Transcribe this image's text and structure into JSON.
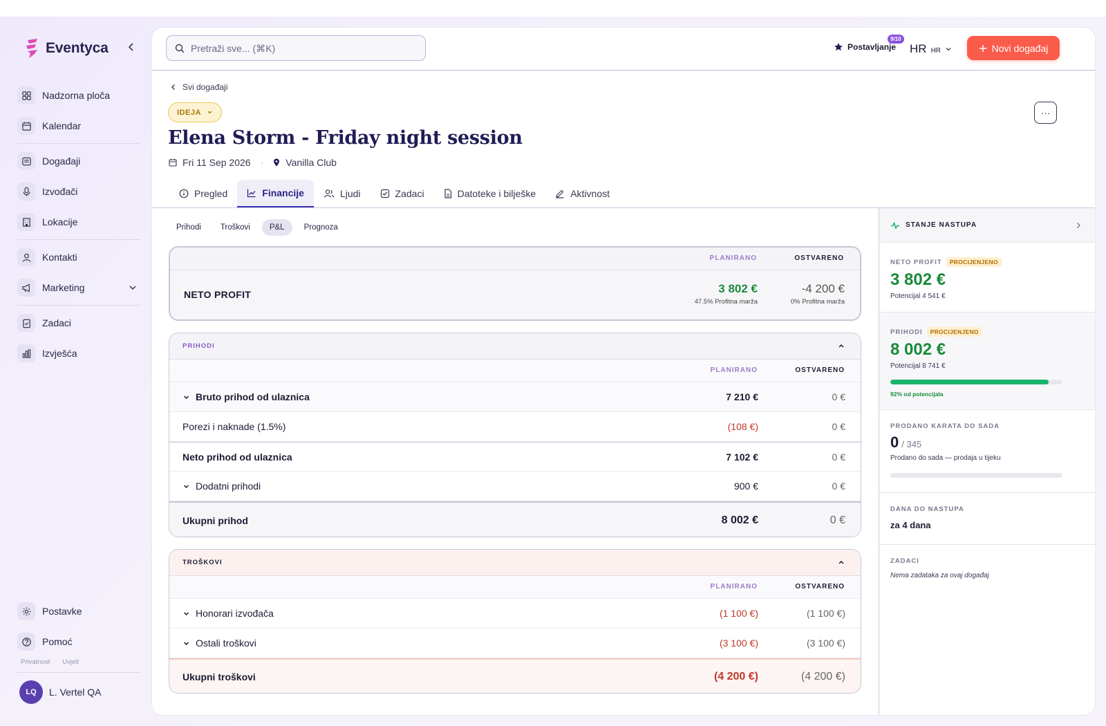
{
  "app": {
    "name": "Eventyca"
  },
  "sidebar": {
    "items": [
      {
        "label": "Nadzorna ploča"
      },
      {
        "label": "Kalendar"
      },
      {
        "label": "Događaji"
      },
      {
        "label": "Izvođači"
      },
      {
        "label": "Lokacije"
      },
      {
        "label": "Kontakti"
      },
      {
        "label": "Marketing"
      },
      {
        "label": "Zadaci"
      },
      {
        "label": "Izvješća"
      }
    ],
    "bottom": [
      {
        "label": "Postavke"
      },
      {
        "label": "Pomoć"
      }
    ],
    "legal": {
      "privacy": "Privatnost",
      "terms": "Uvjeti"
    },
    "user": {
      "initials": "LQ",
      "name": "L. Vertel QA"
    }
  },
  "topbar": {
    "search_placeholder": "Pretraži sve... (⌘K)",
    "setup_label": "Postavljanje",
    "setup_badge": "9/10",
    "lang_main": "HR",
    "lang_code": "HR",
    "new_event": "Novi događaj"
  },
  "event": {
    "breadcrumb": "Svi događaji",
    "status": "IDEJA",
    "title": "Elena Storm - Friday night session",
    "date": "Fri 11 Sep 2026",
    "venue": "Vanilla Club"
  },
  "tabs": [
    {
      "label": "Pregled",
      "icon": "info-icon"
    },
    {
      "label": "Financije",
      "icon": "chart-icon"
    },
    {
      "label": "Ljudi",
      "icon": "people-icon"
    },
    {
      "label": "Zadaci",
      "icon": "checkbox-icon"
    },
    {
      "label": "Datoteke i bilješke",
      "icon": "file-icon"
    },
    {
      "label": "Aktivnost",
      "icon": "pencil-icon"
    }
  ],
  "subtabs": [
    "Prihodi",
    "Troškovi",
    "P&L",
    "Prognoza"
  ],
  "columns": {
    "planned": "PLANIRANO",
    "actual": "OSTVARENO"
  },
  "net_profit": {
    "label": "NETO PROFIT",
    "planned": "3 802 €",
    "planned_note": "47.5% Profitna marža",
    "actual": "-4 200 €",
    "actual_note": "0% Profitna marža"
  },
  "revenue": {
    "title": "PRIHODI",
    "rows": [
      {
        "label": "Bruto prihod od ulaznica",
        "planned": "7 210 €",
        "actual": "0 €"
      },
      {
        "label": "Porezi i naknade (1.5%)",
        "planned": "(108 €)",
        "actual": "0 €"
      },
      {
        "label": "Neto prihod od ulaznica",
        "planned": "7 102 €",
        "actual": "0 €"
      },
      {
        "label": "Dodatni prihodi",
        "planned": "900 €",
        "actual": "0 €"
      }
    ],
    "total": {
      "label": "Ukupni prihod",
      "planned": "8 002 €",
      "actual": "0 €"
    }
  },
  "costs": {
    "title": "TROŠKOVI",
    "rows": [
      {
        "label": "Honorari izvođača",
        "planned": "(1 100 €)",
        "actual": "(1 100 €)"
      },
      {
        "label": "Ostali troškovi",
        "planned": "(3 100 €)",
        "actual": "(3 100 €)"
      }
    ],
    "total": {
      "label": "Ukupni troškovi",
      "planned": "(4 200 €)",
      "actual": "(4 200 €)"
    }
  },
  "rail": {
    "title": "STANJE NASTUPA",
    "net": {
      "label": "NETO PROFIT",
      "tag": "PROCIJENJENO",
      "value": "3 802 €",
      "potential": "Potencijal 4 541 €"
    },
    "income": {
      "label": "PRIHODI",
      "tag": "PROCIJENJENO",
      "value": "8 002 €",
      "potential": "Potencijal 8 741 €",
      "progress": 0.92,
      "progress_label": "92% od potencijala"
    },
    "tickets": {
      "label": "PRODANO KARATA DO SADA",
      "sold": "0",
      "total": "/ 345",
      "note": "Prodano do sada — prodaja u tijeku",
      "progress": 0
    },
    "days": {
      "label": "DANA DO NASTUPA",
      "value": "za 4 dana"
    },
    "tasks": {
      "label": "ZADACI",
      "value": "Nema zadataka za ovaj događaj"
    }
  },
  "colors": {
    "accent": "#3f35b8",
    "cta": "#fb5b4a",
    "positive": "#1a8a3a",
    "negative": "#c0392b"
  }
}
